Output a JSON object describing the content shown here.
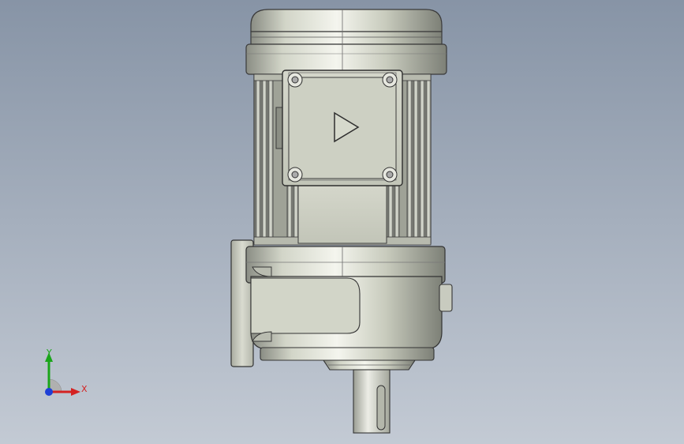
{
  "viewport": {
    "background_top": "#8794a6",
    "background_bottom": "#c3cad4"
  },
  "model": {
    "body_color": "#d8dbcf",
    "edge_color": "#3a3a3a",
    "rotation_icon": "play-triangle-icon"
  },
  "triad": {
    "x_label": "X",
    "y_label": "Y",
    "x_color": "#d42222",
    "y_color": "#1aa51a",
    "z_color": "#1e3fd6"
  }
}
